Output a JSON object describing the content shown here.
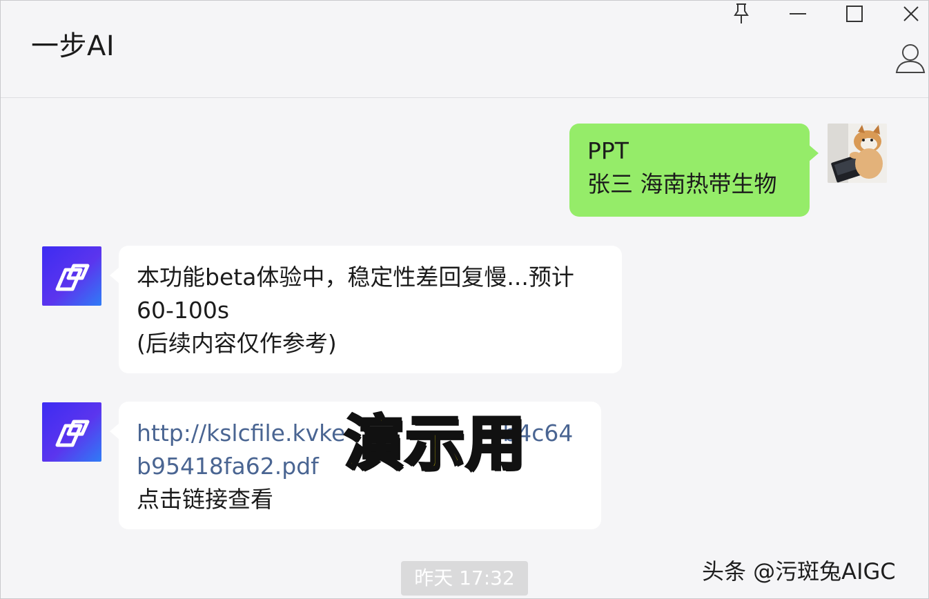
{
  "window": {
    "title": "一步AI"
  },
  "icons": {
    "pin": "pin-icon",
    "minimize": "minimize-icon",
    "maximize": "maximize-icon",
    "close": "close-icon",
    "contact": "person-icon",
    "bot_logo": "bot-logo-icon"
  },
  "colors": {
    "user_bubble": "#95ec69",
    "bot_bubble": "#ffffff",
    "link": "#4a6592",
    "stamp_fill": "#ffe500",
    "bot_avatar_gradient": [
      "#3d2cf2",
      "#2f7cf6"
    ]
  },
  "messages": {
    "user_request": {
      "line1": "PPT",
      "line2": "张三 海南热带生物"
    },
    "bot_notice": {
      "line1": "本功能beta体验中，稳定性差回复慢...预计",
      "line2": "60-100s",
      "line3": "(后续内容仅作参考)"
    },
    "bot_link": {
      "link_line1": "http://kslcfile.kvke",
      "link_line1_tail": "b4c64",
      "link_line2": "b95418fa62.pdf",
      "hint": "点击链接查看"
    }
  },
  "overlay": {
    "stamp_text": "演示用"
  },
  "timestamp": "昨天 17:32",
  "watermark": "头条 @污斑兔AIGC"
}
